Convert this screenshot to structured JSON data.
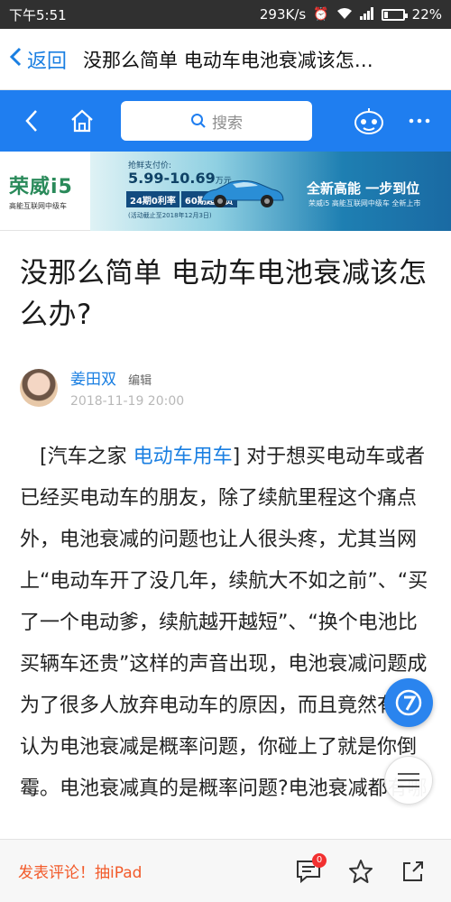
{
  "status_bar": {
    "time": "下午5:51",
    "net_speed": "293K/s",
    "battery": "22%",
    "battery_level": 0.22
  },
  "app_bar": {
    "back_label": "返回",
    "title": "没那么简单 电动车电池衰减该怎…"
  },
  "web_header": {
    "search_placeholder": "搜索"
  },
  "banner": {
    "brand": "荣威i5",
    "brand_sub": "高能互联网中级车",
    "price_label": "抢鲜支付价:",
    "price": "5.99-10.69",
    "price_unit": "万元",
    "offer_1": "24期0利率",
    "offer_2": "60期超长贷",
    "note": "(活动截止至2018年12月3日)",
    "slogan": "全新高能 一步到位",
    "slogan_sub": "荣威i5 高能互联网中级车 全新上市"
  },
  "article": {
    "headline": "没那么简单 电动车电池衰减该怎么办?",
    "author": "姜田双",
    "author_role": "编辑",
    "date": "2018-11-19 20:00",
    "body_prefix": "[汽车之家 ",
    "body_link": "电动车用车",
    "body_text": "] 对于想买电动车或者已经买电动车的朋友，除了续航里程这个痛点外，电池衰减的问题也让人很头疼，尤其当网上“电动车开了没几年，续航大不如之前”、“买了一个电动爹，续航越开越短”、“换个电池比买辆车还贵”这样的声音出现，电池衰减问题成为了很多人放弃电动车的原因，而且竟然有人认为电池衰减是概率问题，你碰上了就是你倒霉。电池衰减真的是概率问题?电池衰减都有哪"
  },
  "bottom_bar": {
    "comment_cta": "发表评论！抽iPad",
    "comment_count": "0"
  }
}
